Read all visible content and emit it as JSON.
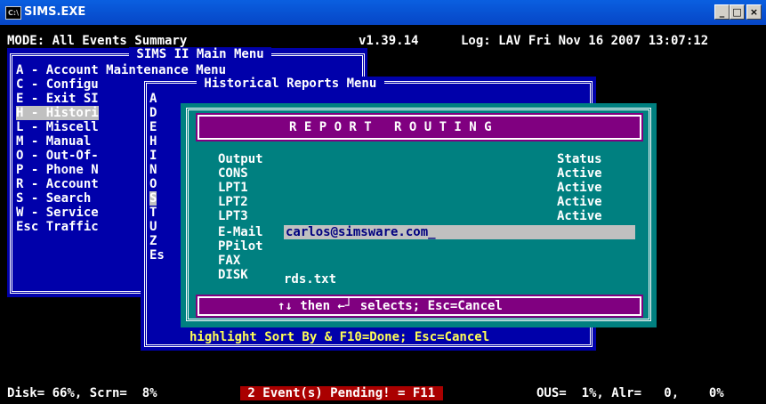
{
  "window": {
    "title": "SIMS.EXE",
    "icon_text": "C:\\",
    "min": "_",
    "max": "□",
    "close": "×"
  },
  "status_line": {
    "mode": "MODE: All Events Summary",
    "version": "v1.39.14",
    "log": "Log: LAV Fri Nov 16 2007 13:07:12"
  },
  "main_menu": {
    "title": " SIMS II Main Menu ",
    "items": [
      "A - Account Maintenance Menu",
      "C - Configu",
      "E - Exit SI",
      "H - Histori",
      "L - Miscell",
      "M - Manual ",
      "O - Out-Of-",
      "P - Phone N",
      "R - Account",
      "S - Search ",
      "W - Service",
      "Esc Traffic"
    ],
    "highlighted_index": 3
  },
  "hist_menu": {
    "title": " Historical Reports Menu ",
    "letters": [
      "A",
      "D",
      "E",
      "H",
      "I",
      "N",
      "O",
      "S",
      "T",
      "U",
      "Z",
      "Es"
    ],
    "highlighted_index": 7,
    "footer": "highlight Sort By & F10=Done; Esc=Cancel"
  },
  "report_routing": {
    "title": "R E P O R T   R O U T I N G",
    "header": {
      "output": "Output",
      "status": "Status"
    },
    "rows": [
      {
        "output": "CONS",
        "status": "Active"
      },
      {
        "output": "LPT1",
        "status": "Active"
      },
      {
        "output": "LPT2",
        "status": "Active"
      },
      {
        "output": "LPT3",
        "status": "Active"
      }
    ],
    "email_label": "E-Mail",
    "email_value": "carlos@simsware.com_",
    "ppilot_label": "PPilot",
    "fax_label": "FAX",
    "disk_label": "DISK",
    "disk_value": "rds.txt",
    "footer": "↑↓ then ←┘ selects; Esc=Cancel"
  },
  "bottom_bar": {
    "disk": "Disk= 66%, Scrn=  8%",
    "pending": " 2 Event(s) Pending! = F11 ",
    "ous": "OUS=  1%, Alr=   0,    0%"
  }
}
